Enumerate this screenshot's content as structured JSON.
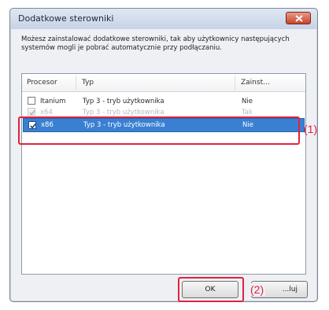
{
  "window": {
    "title": "Dodatkowe sterowniki"
  },
  "description": "Możesz zainstalować dodatkowe sterowniki, tak aby użytkownicy następujących systemów mogli je pobrać automatycznie przy podłączaniu.",
  "list": {
    "columns": [
      "Procesor",
      "Typ",
      "Zainst..."
    ],
    "rows": [
      {
        "processor": "Itanium",
        "type": "Typ 3 - tryb użytkownika",
        "installed": "Nie",
        "checked": false,
        "state": "normal"
      },
      {
        "processor": "x64",
        "type": "Typ 3 - tryb użytkownika",
        "installed": "Tak",
        "checked": true,
        "state": "faded"
      },
      {
        "processor": "x86",
        "type": "Typ 3 - tryb użytkownika",
        "installed": "Nie",
        "checked": true,
        "state": "selected"
      }
    ]
  },
  "buttons": {
    "ok": "OK",
    "cancel_partial": "...luj"
  },
  "annotations": {
    "label_1": "(1)",
    "label_2": "(2)"
  },
  "colors": {
    "selection": "#3a80d2",
    "annotation": "#e0233e"
  }
}
